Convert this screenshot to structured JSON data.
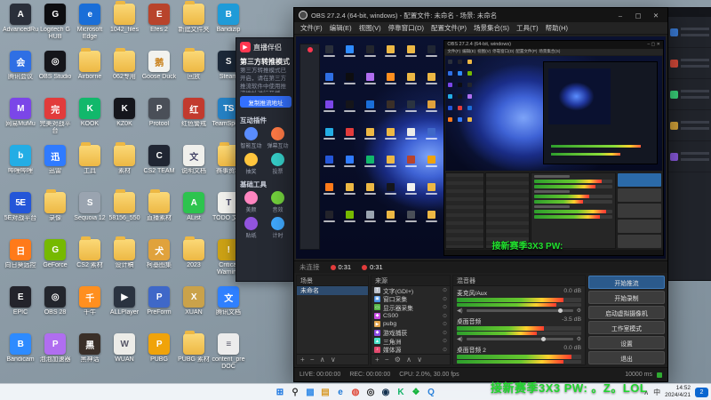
{
  "window": {
    "title": "OBS 27.2.4 (64-bit, windows) - 配置文件: 未命名 - 场景: 未命名"
  },
  "desktop": {
    "icons": [
      {
        "l": "AdvancedRun",
        "c": "#2a2f3a",
        "g": "A"
      },
      {
        "l": "腾讯会议",
        "c": "#2f6fe4",
        "g": "会"
      },
      {
        "l": "网易MuMu",
        "c": "#7b46e8",
        "g": "M"
      },
      {
        "l": "哔哩哔哩",
        "c": "#23ade5",
        "g": "b"
      },
      {
        "l": "5E对战平台",
        "c": "#2456d8",
        "g": "5E"
      },
      {
        "l": "向日葵远控",
        "c": "#ff7a1a",
        "g": "日"
      },
      {
        "l": "EPIC",
        "c": "#23232b",
        "g": "E"
      },
      {
        "l": "Bandicam",
        "c": "#2e8bff",
        "g": "B"
      },
      {
        "l": "Logitech G HUB",
        "c": "#0d0d10",
        "g": "G"
      },
      {
        "l": "OBS Studio",
        "c": "#15151a",
        "g": "◎"
      },
      {
        "l": "完美对战平台",
        "c": "#e23b3b",
        "g": "完"
      },
      {
        "l": "迅雷",
        "c": "#2f7bff",
        "g": "迅"
      },
      {
        "l": "录像",
        "f": true
      },
      {
        "l": "GeForce",
        "c": "#76b900",
        "g": "G"
      },
      {
        "l": "OBS 28",
        "c": "#23262d",
        "g": "◎"
      },
      {
        "l": "泡泡加速器",
        "c": "#b06ef0",
        "g": "P"
      },
      {
        "l": "Microsoft Edge",
        "c": "#1a6ed8",
        "g": "e"
      },
      {
        "l": "Airborne",
        "f": true
      },
      {
        "l": "KOOK",
        "c": "#11b86b",
        "g": "K"
      },
      {
        "l": "工具",
        "f": true
      },
      {
        "l": "Sequoia 12",
        "c": "#9aa4b0",
        "g": "S"
      },
      {
        "l": "CS2 素材",
        "f": true
      },
      {
        "l": "千牛",
        "c": "#ff8f1f",
        "g": "千"
      },
      {
        "l": "黑神话",
        "c": "#3a2f28",
        "g": "黑"
      },
      {
        "l": "1042_files",
        "f": true
      },
      {
        "l": "062专用",
        "f": true
      },
      {
        "l": "KZ0K",
        "c": "#15161c",
        "g": "K"
      },
      {
        "l": "素材",
        "f": true
      },
      {
        "l": "58156_550",
        "f": true
      },
      {
        "l": "设计稿",
        "f": true
      },
      {
        "l": "ALLPlayer",
        "c": "#2a3340",
        "g": "▶"
      },
      {
        "l": "WUAN",
        "c": "#ecece8",
        "g": "W",
        "tc": "#556"
      },
      {
        "l": "Efes 2",
        "c": "#b8442c",
        "g": "E"
      },
      {
        "l": "Goose Duck",
        "c": "#f2f2ee",
        "g": "鹅",
        "tc": "#c9801a"
      },
      {
        "l": "Protool",
        "c": "#4a4f58",
        "g": "P"
      },
      {
        "l": "CS2 TEAM",
        "c": "#202633",
        "g": "C"
      },
      {
        "l": "直播素材",
        "f": true
      },
      {
        "l": "柯基图集",
        "c": "#e0a23c",
        "g": "犬"
      },
      {
        "l": "PreForm",
        "c": "#3f68c8",
        "g": "P"
      },
      {
        "l": "PUBG",
        "c": "#f0a30a",
        "g": "P"
      },
      {
        "l": "新建文件夹",
        "f": true
      },
      {
        "l": "回放",
        "f": true
      },
      {
        "l": "红色警戒",
        "c": "#c23a2e",
        "g": "红"
      },
      {
        "l": "说明文档",
        "c": "#f0f0ec",
        "g": "文",
        "tc": "#446"
      },
      {
        "l": "AList",
        "c": "#2dc44e",
        "g": "A"
      },
      {
        "l": "2023",
        "f": true
      },
      {
        "l": "XUAN",
        "c": "#caa24a",
        "g": "X"
      },
      {
        "l": "PUBG 素材",
        "f": true
      },
      {
        "l": "Bandizip",
        "c": "#1f9bd8",
        "g": "B"
      },
      {
        "l": "Steam",
        "c": "#1b2838",
        "g": "S"
      },
      {
        "l": "TeamSpeak",
        "c": "#2580c3",
        "g": "TS"
      },
      {
        "l": "赛事资料",
        "f": true
      },
      {
        "l": "TODO 文档",
        "c": "#f0f0ec",
        "g": "T",
        "tc": "#446"
      },
      {
        "l": "Critical Warning",
        "c": "#caa015",
        "g": "!"
      },
      {
        "l": "腾讯文档",
        "c": "#2f80ff",
        "g": "文"
      },
      {
        "l": "content_pre DOC",
        "c": "#ececec",
        "g": "≡",
        "tc": "#556"
      }
    ]
  },
  "companion": {
    "title": "直播伴侣",
    "mode_title": "第三方转推模式",
    "mode_desc": "第三方转推模式已开启，请在第三方推流软件中使用推流地址进行开播",
    "copy_button": "复制推流地址",
    "sections": [
      {
        "label": "互动插件",
        "tools": [
          {
            "label": "智能互动",
            "color": "#5a8dff"
          },
          {
            "label": "弹幕互动",
            "color": "#ff7a45"
          },
          {
            "label": "抽奖",
            "color": "#ffc53d"
          },
          {
            "label": "投票",
            "color": "#36cfc9"
          }
        ]
      },
      {
        "label": "基础工具",
        "tools": [
          {
            "label": "美颜",
            "color": "#ff85c0"
          },
          {
            "label": "音效",
            "color": "#73d13d"
          },
          {
            "label": "贴纸",
            "color": "#9254de"
          },
          {
            "label": "计时",
            "color": "#40a9ff"
          }
        ]
      }
    ]
  },
  "obs": {
    "menus": [
      "文件(F)",
      "编辑(E)",
      "视图(V)",
      "停靠窗口(D)",
      "配置文件(P)",
      "场景集合(S)",
      "工具(T)",
      "帮助(H)"
    ],
    "nested_title": "OBS 27.2.4 (64-bit, windows)",
    "connection_status": "未连接",
    "timers": [
      {
        "time": "0:31"
      },
      {
        "time": "0:31"
      }
    ],
    "scenes": {
      "title": "场景",
      "items": [
        "未命名"
      ],
      "toolbar": "+ − ∧ ∨"
    },
    "sources": {
      "title": "来源",
      "toolbar": "+ − ⚙ ∧ ∨",
      "items": [
        {
          "icon": "T",
          "color": "#b8bec8",
          "label": "文字(GDI+)"
        },
        {
          "icon": "▣",
          "color": "#4a90e2",
          "label": "窗口采集"
        },
        {
          "icon": "▭",
          "color": "#57b847",
          "label": "显示器采集"
        },
        {
          "icon": "◆",
          "color": "#c84ae2",
          "label": "CS00"
        },
        {
          "icon": "▶",
          "color": "#e2a34a",
          "label": "pubg"
        },
        {
          "icon": "◆",
          "color": "#8a4ae2",
          "label": "游戏捕获"
        },
        {
          "icon": "▲",
          "color": "#4ae2c8",
          "label": "三角洲"
        },
        {
          "icon": "♪",
          "color": "#e24a6e",
          "label": "媒体源"
        }
      ]
    },
    "mixer": {
      "title": "混音器",
      "channels": [
        {
          "name": "麦克风/Aux",
          "db": "0.0 dB",
          "level": 86
        },
        {
          "name": "桌面音频",
          "db": "-3.5 dB",
          "level": 70
        },
        {
          "name": "桌面音频 2",
          "db": "0.0 dB",
          "level": 92
        }
      ]
    },
    "controls": {
      "buttons": [
        "开始推流",
        "开始录制",
        "启动虚拟摄像机",
        "工作室模式",
        "设置",
        "退出"
      ]
    },
    "status": {
      "live": "LIVE: 00:00:00",
      "rec": "REC: 00:00:00",
      "cpu": "CPU: 2.0%, 30.00 fps",
      "latency": "10000 ms"
    }
  },
  "overlay": {
    "mid": "接新赛季3X3 PW:",
    "bottom": "接新赛季3X3 PW: 。Z。LOL"
  },
  "taskbar": {
    "lang": "中",
    "time": "14:52",
    "date": "2024/4/21",
    "badge": "2",
    "icons": [
      {
        "name": "start",
        "glyph": "⊞",
        "color": "#0f6fe0"
      },
      {
        "name": "search",
        "glyph": "⚲",
        "color": "#333333"
      },
      {
        "name": "widgets",
        "glyph": "▩",
        "color": "#3a8fe8"
      },
      {
        "name": "file-explorer",
        "glyph": "▤",
        "color": "#d89b2a"
      },
      {
        "name": "edge",
        "glyph": "e",
        "color": "#1a78d8"
      },
      {
        "name": "chrome",
        "glyph": "◍",
        "color": "#e04a3a"
      },
      {
        "name": "obs",
        "glyph": "◎",
        "color": "#1c1c1c"
      },
      {
        "name": "steam",
        "glyph": "◉",
        "color": "#12304e"
      },
      {
        "name": "kook",
        "glyph": "K",
        "color": "#16b46a"
      },
      {
        "name": "wechat",
        "glyph": "❖",
        "color": "#12b33a"
      },
      {
        "name": "qq",
        "glyph": "Q",
        "color": "#2b82d9"
      }
    ]
  }
}
